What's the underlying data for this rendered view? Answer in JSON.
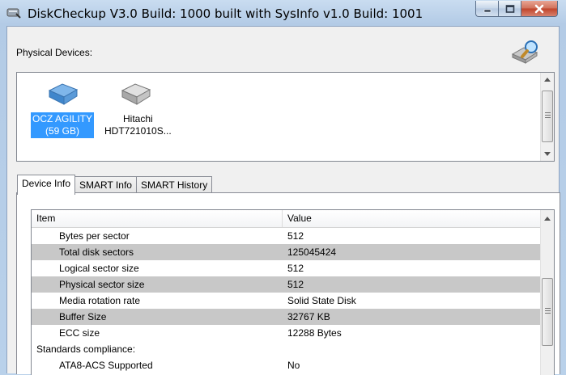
{
  "window": {
    "title": "DiskCheckup V3.0 Build: 1000 built with SysInfo v1.0 Build: 1001"
  },
  "physical_devices": {
    "label": "Physical Devices:",
    "devices": [
      {
        "name": "OCZ AGILITY (59 GB)",
        "line1": "OCZ AGILITY",
        "line2": "(59 GB)",
        "selected": true,
        "icon": "ssd-drive-icon",
        "color": "#4a90d9"
      },
      {
        "name": "Hitachi HDT721010S...",
        "line1": "Hitachi",
        "line2": "HDT721010S...",
        "selected": false,
        "icon": "hard-drive-icon",
        "color": "#b0b0b0"
      }
    ]
  },
  "tabs": [
    {
      "label": "Device Info",
      "active": true
    },
    {
      "label": "SMART Info",
      "active": false
    },
    {
      "label": "SMART History",
      "active": false
    }
  ],
  "table": {
    "columns": [
      "Item",
      "Value"
    ],
    "rows": [
      {
        "item": "Bytes per sector",
        "value": "512",
        "indent": true,
        "shaded": false
      },
      {
        "item": "Total disk sectors",
        "value": "125045424",
        "indent": true,
        "shaded": true
      },
      {
        "item": "Logical sector size",
        "value": "512",
        "indent": true,
        "shaded": false
      },
      {
        "item": "Physical sector size",
        "value": "512",
        "indent": true,
        "shaded": true
      },
      {
        "item": "Media rotation rate",
        "value": "Solid State Disk",
        "indent": true,
        "shaded": false
      },
      {
        "item": "Buffer Size",
        "value": "32767 KB",
        "indent": true,
        "shaded": true
      },
      {
        "item": "ECC size",
        "value": "12288 Bytes",
        "indent": true,
        "shaded": false
      },
      {
        "item": "Standards compliance:",
        "value": "",
        "indent": false,
        "shaded": false
      },
      {
        "item": "ATA8-ACS Supported",
        "value": "No",
        "indent": true,
        "shaded": false
      }
    ]
  },
  "colors": {
    "selection": "#3399ff",
    "row_shade": "#c8c8c8",
    "close_button": "#c0432a"
  }
}
